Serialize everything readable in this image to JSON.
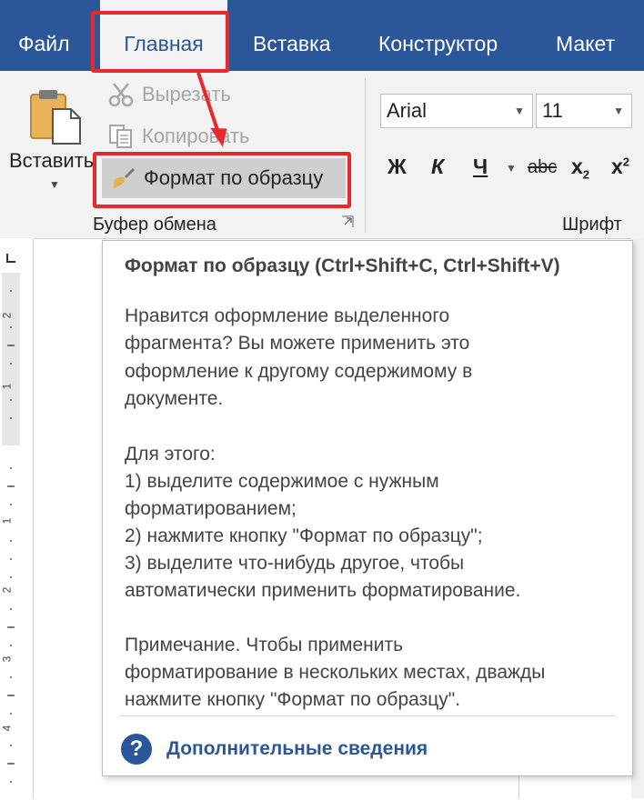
{
  "tabs": [
    {
      "label": "Файл"
    },
    {
      "label": "Главная"
    },
    {
      "label": "Вставка"
    },
    {
      "label": "Конструктор"
    },
    {
      "label": "Макет"
    }
  ],
  "clipboard": {
    "paste_label": "Вставить",
    "cut_label": "Вырезать",
    "copy_label": "Копировать",
    "format_painter_label": "Формат по образцу",
    "group_label": "Буфер обмена"
  },
  "font": {
    "font_name": "Arial",
    "font_size": "11",
    "bold": "Ж",
    "italic": "К",
    "underline": "Ч",
    "strikethrough": "abc",
    "subscript_base": "x",
    "subscript_sub": "2",
    "superscript_base": "x",
    "superscript_sup": "2",
    "group_label": "Шрифт"
  },
  "ruler_numbers": [
    "2",
    "1",
    "1",
    "2",
    "3",
    "4"
  ],
  "tooltip": {
    "title": "Формат по образцу (Ctrl+Shift+C, Ctrl+Shift+V)",
    "para1": [
      "Нравится оформление выделенного",
      "фрагмента? Вы можете применить это",
      "оформление к другому содержимому в",
      "документе."
    ],
    "para2": [
      "Для этого:",
      "1) выделите содержимое с нужным",
      "форматированием;",
      "2) нажмите кнопку \"Формат по образцу\";",
      "3) выделите что-нибудь другое, чтобы",
      "автоматически применить форматирование."
    ],
    "para3": [
      "Примечание. Чтобы применить",
      "форматирование в нескольких местах, дважды",
      "нажмите кнопку \"Формат по образцу\"."
    ],
    "help_label": "Дополнительные сведения"
  },
  "colors": {
    "tabbar": "#2b579a",
    "ribbon": "#f3f3f3",
    "highlight": "#e8282a",
    "link": "#2b579a"
  },
  "icons": {
    "paste": "clipboard-paste-icon",
    "cut": "scissors-icon",
    "copy": "copy-icon",
    "format_painter": "paintbrush-icon",
    "help": "question-circle-icon"
  }
}
